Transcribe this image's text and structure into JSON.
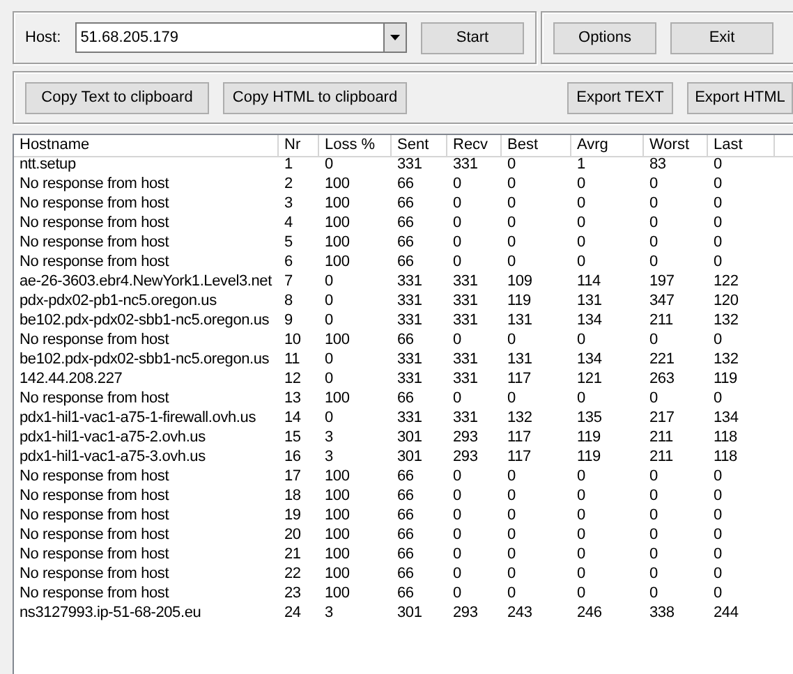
{
  "host": {
    "label": "Host:",
    "value": "51.68.205.179"
  },
  "buttons": {
    "start": "Start",
    "options": "Options",
    "exit": "Exit",
    "copy_text": "Copy Text to clipboard",
    "copy_html": "Copy HTML to clipboard",
    "export_text": "Export TEXT",
    "export_html": "Export HTML"
  },
  "table": {
    "columns": [
      "Hostname",
      "Nr",
      "Loss %",
      "Sent",
      "Recv",
      "Best",
      "Avrg",
      "Worst",
      "Last"
    ],
    "rows": [
      [
        "ntt.setup",
        "1",
        "0",
        "331",
        "331",
        "0",
        "1",
        "83",
        "0"
      ],
      [
        "No response from host",
        "2",
        "100",
        "66",
        "0",
        "0",
        "0",
        "0",
        "0"
      ],
      [
        "No response from host",
        "3",
        "100",
        "66",
        "0",
        "0",
        "0",
        "0",
        "0"
      ],
      [
        "No response from host",
        "4",
        "100",
        "66",
        "0",
        "0",
        "0",
        "0",
        "0"
      ],
      [
        "No response from host",
        "5",
        "100",
        "66",
        "0",
        "0",
        "0",
        "0",
        "0"
      ],
      [
        "No response from host",
        "6",
        "100",
        "66",
        "0",
        "0",
        "0",
        "0",
        "0"
      ],
      [
        "ae-26-3603.ebr4.NewYork1.Level3.net",
        "7",
        "0",
        "331",
        "331",
        "109",
        "114",
        "197",
        "122"
      ],
      [
        "pdx-pdx02-pb1-nc5.oregon.us",
        "8",
        "0",
        "331",
        "331",
        "119",
        "131",
        "347",
        "120"
      ],
      [
        "be102.pdx-pdx02-sbb1-nc5.oregon.us",
        "9",
        "0",
        "331",
        "331",
        "131",
        "134",
        "211",
        "132"
      ],
      [
        "No response from host",
        "10",
        "100",
        "66",
        "0",
        "0",
        "0",
        "0",
        "0"
      ],
      [
        "be102.pdx-pdx02-sbb1-nc5.oregon.us",
        "11",
        "0",
        "331",
        "331",
        "131",
        "134",
        "221",
        "132"
      ],
      [
        "142.44.208.227",
        "12",
        "0",
        "331",
        "331",
        "117",
        "121",
        "263",
        "119"
      ],
      [
        "No response from host",
        "13",
        "100",
        "66",
        "0",
        "0",
        "0",
        "0",
        "0"
      ],
      [
        "pdx1-hil1-vac1-a75-1-firewall.ovh.us",
        "14",
        "0",
        "331",
        "331",
        "132",
        "135",
        "217",
        "134"
      ],
      [
        "pdx1-hil1-vac1-a75-2.ovh.us",
        "15",
        "3",
        "301",
        "293",
        "117",
        "119",
        "211",
        "118"
      ],
      [
        "pdx1-hil1-vac1-a75-3.ovh.us",
        "16",
        "3",
        "301",
        "293",
        "117",
        "119",
        "211",
        "118"
      ],
      [
        "No response from host",
        "17",
        "100",
        "66",
        "0",
        "0",
        "0",
        "0",
        "0"
      ],
      [
        "No response from host",
        "18",
        "100",
        "66",
        "0",
        "0",
        "0",
        "0",
        "0"
      ],
      [
        "No response from host",
        "19",
        "100",
        "66",
        "0",
        "0",
        "0",
        "0",
        "0"
      ],
      [
        "No response from host",
        "20",
        "100",
        "66",
        "0",
        "0",
        "0",
        "0",
        "0"
      ],
      [
        "No response from host",
        "21",
        "100",
        "66",
        "0",
        "0",
        "0",
        "0",
        "0"
      ],
      [
        "No response from host",
        "22",
        "100",
        "66",
        "0",
        "0",
        "0",
        "0",
        "0"
      ],
      [
        "No response from host",
        "23",
        "100",
        "66",
        "0",
        "0",
        "0",
        "0",
        "0"
      ],
      [
        "ns3127993.ip-51-68-205.eu",
        "24",
        "3",
        "301",
        "293",
        "243",
        "246",
        "338",
        "244"
      ]
    ]
  }
}
